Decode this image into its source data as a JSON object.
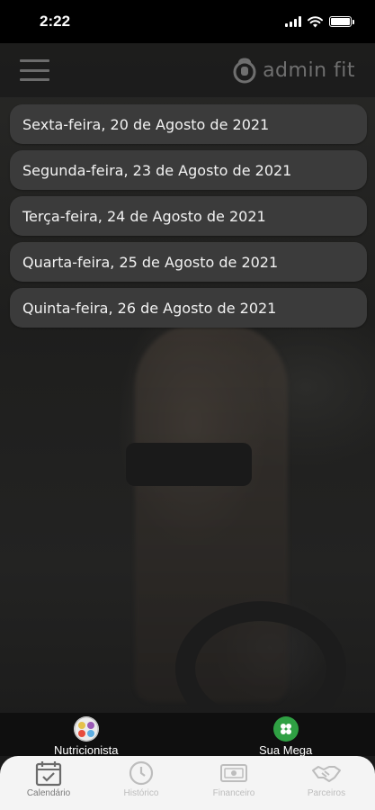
{
  "status_bar": {
    "time": "2:22"
  },
  "header": {
    "brand_name": "admin fit",
    "menu_icon": "hamburger-icon",
    "logo_icon": "kettlebell-icon"
  },
  "dates": [
    {
      "label": "Sexta-feira, 20 de Agosto de 2021"
    },
    {
      "label": "Segunda-feira, 23 de Agosto de 2021"
    },
    {
      "label": "Terça-feira, 24 de Agosto de 2021"
    },
    {
      "label": "Quarta-feira, 25 de Agosto de 2021"
    },
    {
      "label": "Quinta-feira, 26 de Agosto de 2021"
    }
  ],
  "quick_actions": {
    "nutricionista": {
      "label": "Nutricionista",
      "icon": "nutrition-icon"
    },
    "mega": {
      "label": "Sua Mega",
      "icon": "mega-icon",
      "color": "#2fa043"
    }
  },
  "tabs": [
    {
      "label": "Calendário",
      "icon": "calendar-icon",
      "active": true
    },
    {
      "label": "Histórico",
      "icon": "clock-icon",
      "active": false
    },
    {
      "label": "Financeiro",
      "icon": "money-icon",
      "active": false
    },
    {
      "label": "Parceiros",
      "icon": "handshake-icon",
      "active": false
    }
  ]
}
